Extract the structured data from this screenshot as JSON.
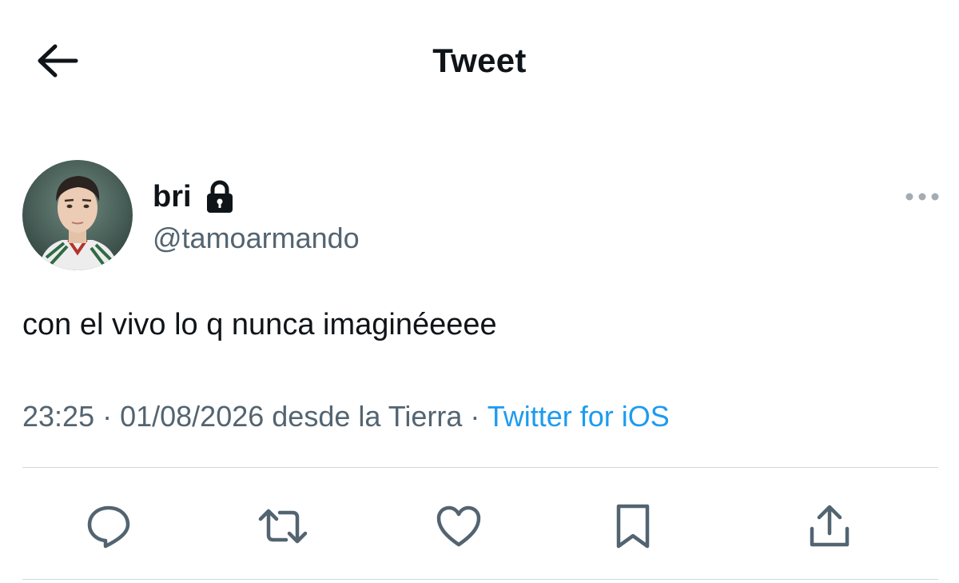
{
  "header": {
    "title": "Tweet",
    "back_icon": "arrow-left-icon"
  },
  "author": {
    "display_name": "bri",
    "handle": "@tamoarmando",
    "protected_icon": "lock-icon",
    "avatar_icon": "profile-photo"
  },
  "tweet": {
    "text": "con el vivo lo q nunca imaginéeeee",
    "time": "23:25",
    "separator": " · ",
    "date": "01/08/2026",
    "location": " desde la Tierra",
    "source": "Twitter for iOS"
  },
  "actions": [
    {
      "name": "reply",
      "icon": "reply-icon"
    },
    {
      "name": "retweet",
      "icon": "retweet-icon"
    },
    {
      "name": "like",
      "icon": "heart-icon"
    },
    {
      "name": "bookmark",
      "icon": "bookmark-icon"
    },
    {
      "name": "share",
      "icon": "share-icon"
    }
  ],
  "colors": {
    "text": "#0f1419",
    "secondary": "#536471",
    "link": "#1d9bf0",
    "divider": "#cfd9de"
  }
}
